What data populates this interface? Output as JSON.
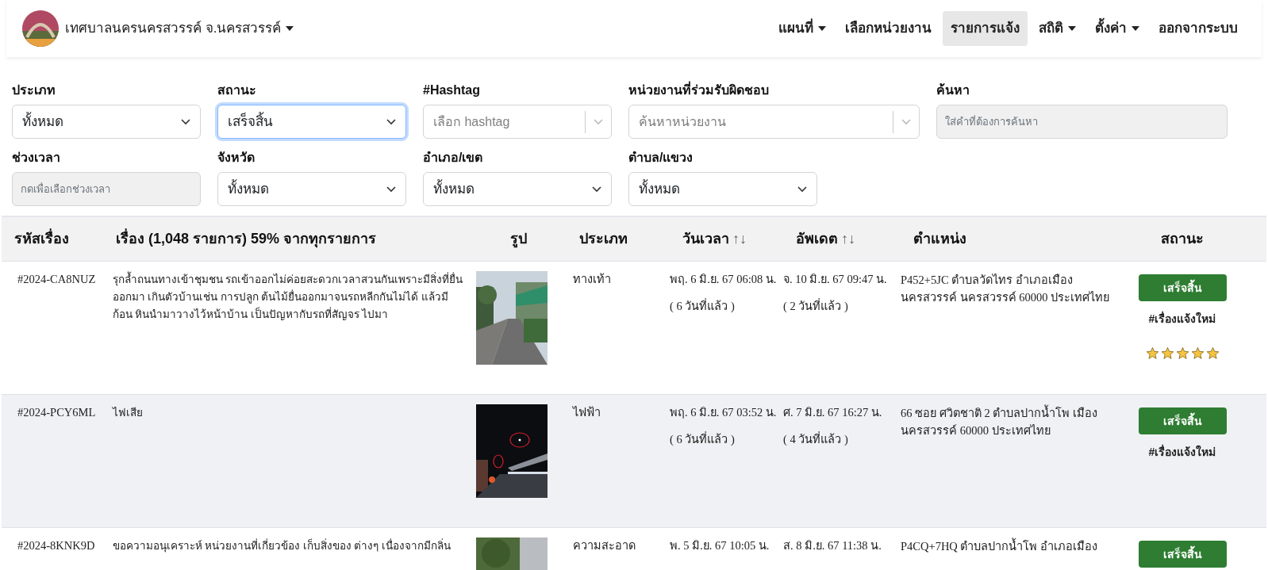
{
  "navbar": {
    "brand": "เทศบาลนครนครสวรรค์ จ.นครสวรรค์",
    "brand_dropdown": true,
    "menu": [
      {
        "label": "แผนที่",
        "dropdown": true,
        "selected": false
      },
      {
        "label": "เลือกหน่วยงาน",
        "dropdown": false,
        "selected": false
      },
      {
        "label": "รายการแจ้ง",
        "dropdown": false,
        "selected": true
      },
      {
        "label": "สถิติ",
        "dropdown": true,
        "selected": false
      },
      {
        "label": "ตั้งค่า",
        "dropdown": true,
        "selected": false
      },
      {
        "label": "ออกจากระบบ",
        "dropdown": false,
        "selected": false
      }
    ]
  },
  "filters": [
    [
      {
        "label": "ประเภท",
        "kind": "select",
        "value": "ทั้งหมด",
        "focused": false
      },
      {
        "label": "สถานะ",
        "kind": "select",
        "value": "เสร็จสิ้น",
        "focused": true
      },
      {
        "label": "#Hashtag",
        "kind": "combo",
        "placeholder": "เลือก hashtag",
        "focused": false
      },
      {
        "label": "หน่วยงานที่ร่วมรับผิดชอบ",
        "kind": "combo",
        "placeholder": "ค้นหาหน่วยงาน",
        "focused": false
      },
      {
        "label": "ค้นหา",
        "kind": "input",
        "placeholder": "ใส่คำที่ต้องการค้นหา",
        "focused": false
      }
    ],
    [
      {
        "label": "ช่วงเวลา",
        "kind": "input",
        "placeholder": "กดเพื่อเลือกช่วงเวลา",
        "focused": false
      },
      {
        "label": "จังหวัด",
        "kind": "select",
        "value": "ทั้งหมด",
        "focused": false
      },
      {
        "label": "อำเภอ/เขต",
        "kind": "select",
        "value": "ทั้งหมด",
        "focused": false
      },
      {
        "label": "ตำบล/แขวง",
        "kind": "select",
        "value": "ทั้งหมด",
        "focused": false
      }
    ]
  ],
  "table": {
    "columns": [
      {
        "label": "รหัสเรื่อง",
        "sortable": false
      },
      {
        "label": "เรื่อง (1,048 รายการ) 59% จากทุกรายการ",
        "sortable": false
      },
      {
        "label": "รูป",
        "sortable": false
      },
      {
        "label": "ประเภท",
        "sortable": false
      },
      {
        "label": "วันเวลา",
        "sortable": true,
        "sort_icon": "↑↓"
      },
      {
        "label": "อัพเดต",
        "sortable": true,
        "sort_icon": "↑↓"
      },
      {
        "label": "ตำแหน่ง",
        "sortable": false
      },
      {
        "label": "สถานะ",
        "sortable": false
      }
    ],
    "rows": [
      {
        "id": "#2024-CA8NUZ",
        "title": "รุกล้ำถนนทางเข้าชุมชน รถเข้าออกไม่ค่อยสะดวกเวลาสวนกันเพราะมีสิ่งที่ยื่นออกมา เกินตัวบ้านเช่น การปลูก ต้นไม้ยื่นออกมาจนรถหลีกกันไม่ได้ แล้วมีก้อน หินนำมาวางไว้หน้าบ้าน เป็นปัญหากับรถที่สัญจร ไปมา",
        "type": "ทางเท้า",
        "created": "พฤ. 6 มิ.ย. 67 06:08 น.",
        "created_ago": "( 6 วันที่แล้ว )",
        "updated": "จ. 10 มิ.ย. 67 09:47 น.",
        "updated_ago": "( 2 วันที่แล้ว )",
        "location": "P452+5JC ตำบลวัดไทร อำเภอเมืองนครสวรรค์ นครสวรรค์ 60000 ประเทศไทย",
        "status": "เสร็จสิ้น",
        "tag": "#เรื่องแจ้งใหม่",
        "stars": 5
      },
      {
        "id": "#2024-PCY6ML",
        "title": "ไฟเสีย",
        "type": "ไฟฟ้า",
        "created": "พฤ. 6 มิ.ย. 67 03:52 น.",
        "created_ago": "( 6 วันที่แล้ว )",
        "updated": "ศ. 7 มิ.ย. 67 16:27 น.",
        "updated_ago": "( 4 วันที่แล้ว )",
        "location": "66 ซอย ศวิตชาติ 2 ตำบลปากน้ำโพ เมือง นครสวรรค์ 60000 ประเทศไทย",
        "status": "เสร็จสิ้น",
        "tag": "#เรื่องแจ้งใหม่"
      },
      {
        "id": "#2024-8KNK9D",
        "title": "ขอความอนุเคราะห์ หน่วยงานที่เกี่ยวข้อง เก็บสิ่งของ ต่างๆ เนื่องจากมีกลิ่น",
        "type": "ความสะอาด",
        "created": "พ. 5 มิ.ย. 67 10:05 น.",
        "updated": "ส. 8 มิ.ย. 67 11:38 น.",
        "location": "P4CQ+7HQ ตำบลปากน้ำโพ อำเภอเมือง",
        "status": "เสร็จสิ้น"
      }
    ]
  }
}
